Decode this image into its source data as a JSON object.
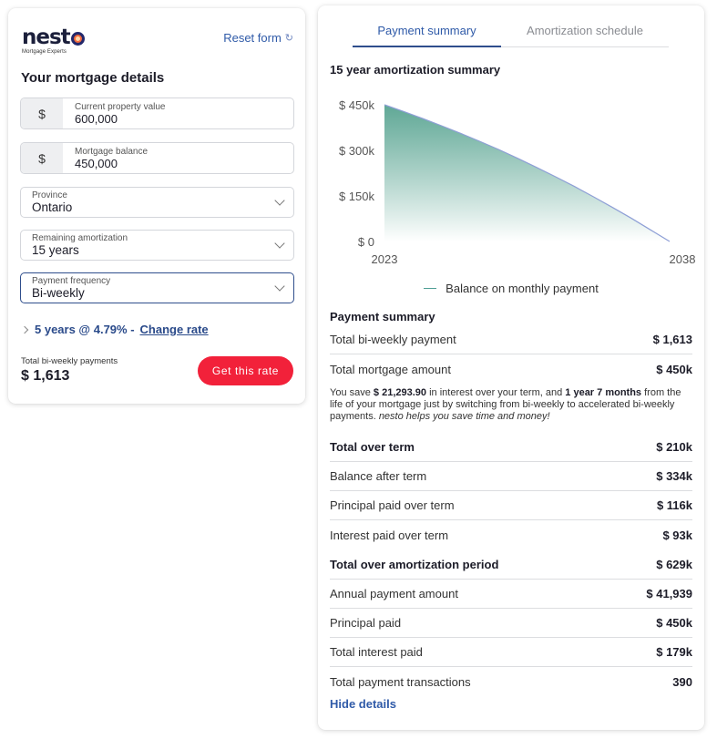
{
  "brand": {
    "name": "nest",
    "tagline": "Mortgage Experts",
    "logo_accent": "#f36b3d"
  },
  "left": {
    "reset_label": "Reset form",
    "reset_icon": "refresh-icon",
    "title": "Your mortgage details",
    "fields": {
      "property_value": {
        "label": "Current property value",
        "prefix": "$",
        "value": "600,000"
      },
      "mortgage_balance": {
        "label": "Mortgage balance",
        "prefix": "$",
        "value": "450,000"
      },
      "province": {
        "label": "Province",
        "value": "Ontario"
      },
      "amortization": {
        "label": "Remaining amortization",
        "value": "15 years"
      },
      "frequency": {
        "label": "Payment frequency",
        "value": "Bi-weekly"
      }
    },
    "rate_text": "5 years @ 4.79% -",
    "change_rate_label": "Change rate",
    "total_label": "Total bi-weekly payments",
    "total_value": "$ 1,613",
    "cta_label": "Get this rate",
    "cta_color": "#f2213a"
  },
  "right": {
    "tabs": [
      {
        "label": "Payment summary",
        "active": true
      },
      {
        "label": "Amortization schedule",
        "active": false
      }
    ],
    "chart_title": "15 year amortization summary",
    "payment_summary_title": "Payment summary",
    "rows_a": [
      {
        "label": "Total bi-weekly payment",
        "value": "$ 1,613"
      },
      {
        "label": "Total mortgage amount",
        "value": "$ 450k"
      }
    ],
    "note": {
      "p1": "You save ",
      "savings": "$ 21,293.90",
      "p2": " in interest over your term, and ",
      "time_saved": "1 year 7 months",
      "p3": " from the life of your mortgage just by switching from bi-weekly to accelerated bi-weekly payments. ",
      "tagline": "nesto helps you save time and money!"
    },
    "rows_b": [
      {
        "label": "Total over term",
        "value": "$ 210k"
      },
      {
        "label": "Balance after term",
        "value": "$ 334k"
      },
      {
        "label": "Principal paid over term",
        "value": "$ 116k"
      },
      {
        "label": "Interest paid over term",
        "value": "$ 93k"
      }
    ],
    "rows_c": [
      {
        "label": "Total over amortization period",
        "value": "$ 629k"
      },
      {
        "label": "Annual payment amount",
        "value": "$ 41,939"
      },
      {
        "label": "Principal paid",
        "value": "$ 450k"
      },
      {
        "label": "Total interest paid",
        "value": "$ 179k"
      },
      {
        "label": "Total payment transactions",
        "value": "390"
      }
    ],
    "hide_details_label": "Hide details"
  },
  "chart_data": {
    "type": "area",
    "title": "15 year amortization summary",
    "xlabel": "",
    "ylabel": "",
    "x": [
      2023,
      2024,
      2025,
      2026,
      2027,
      2028,
      2029,
      2030,
      2031,
      2032,
      2033,
      2034,
      2035,
      2036,
      2037,
      2038
    ],
    "series": [
      {
        "name": "Balance on monthly payment",
        "values": [
          450000,
          428000,
          405000,
          381000,
          356000,
          330000,
          303000,
          274000,
          244000,
          213000,
          181000,
          147000,
          112000,
          76000,
          38000,
          0
        ],
        "color": "#8e9fd6",
        "fill_top": "#4e9e8a",
        "fill_bottom": "#ffffff"
      }
    ],
    "x_tick_labels": [
      "2023",
      "2038"
    ],
    "y_tick_labels": [
      "$ 0",
      "$ 150k",
      "$ 300k",
      "$ 450k"
    ],
    "y_ticks": [
      0,
      150000,
      300000,
      450000
    ],
    "ylim": [
      0,
      450000
    ],
    "xlim": [
      2023,
      2038
    ],
    "grid": false,
    "legend": "bottom-center"
  }
}
